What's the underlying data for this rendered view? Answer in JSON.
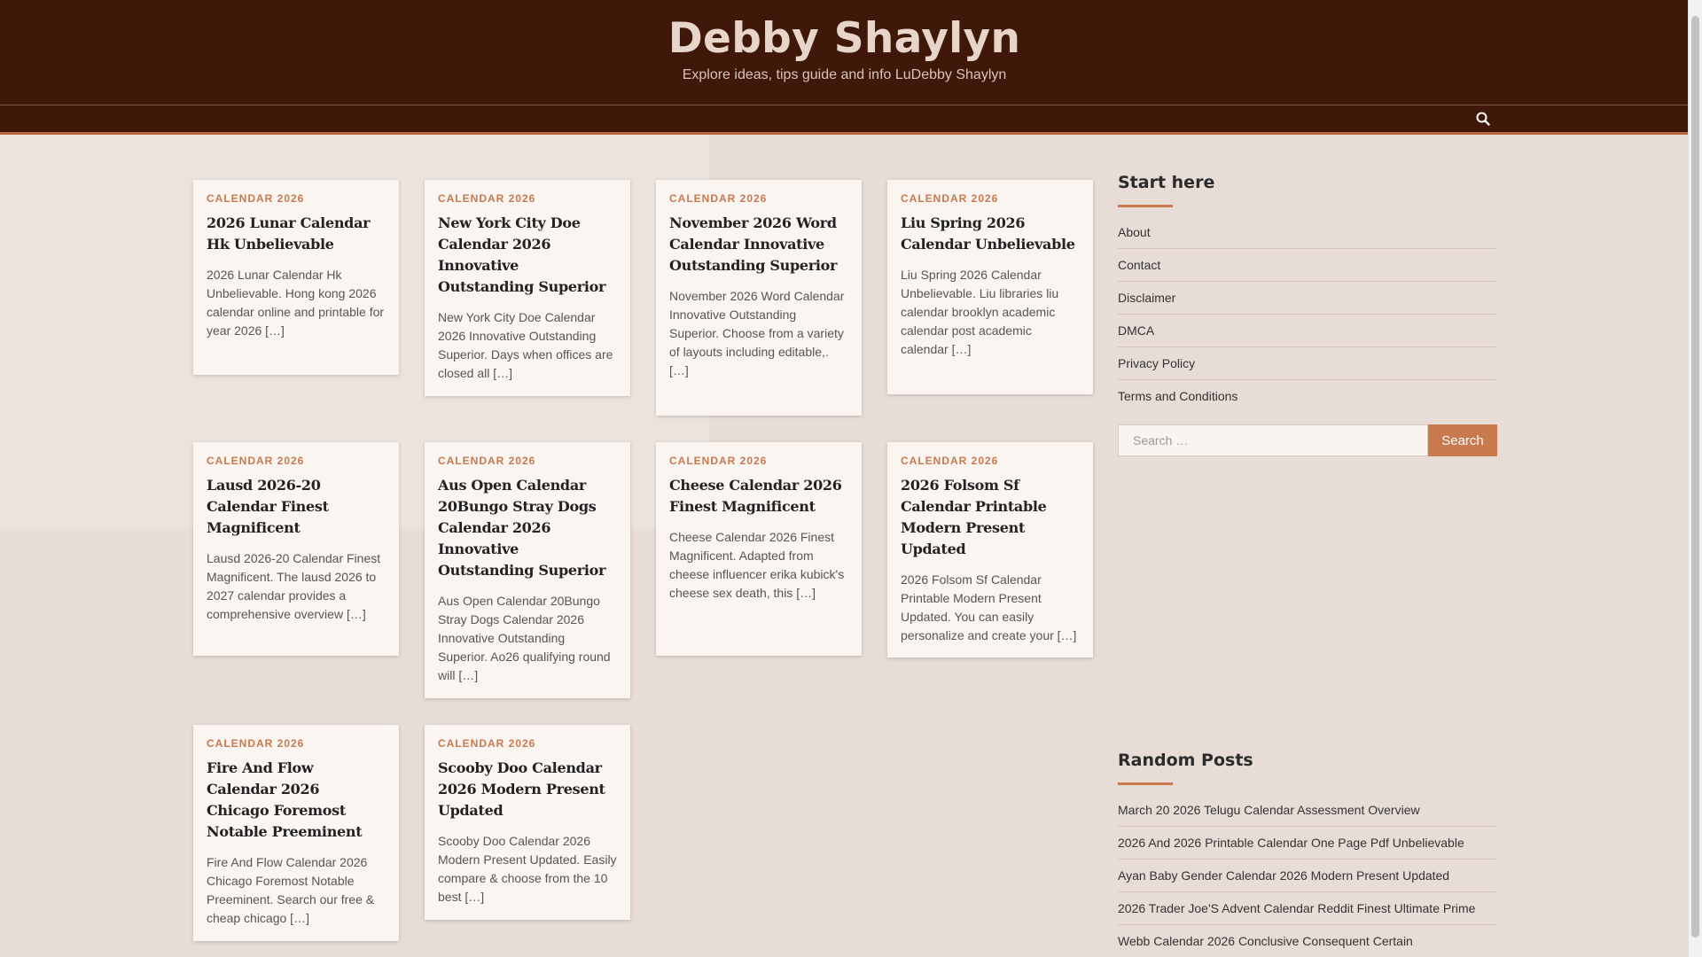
{
  "site": {
    "title": "Debby Shaylyn",
    "description": "Explore ideas, tips guide and info LuDebby Shaylyn"
  },
  "nav": {
    "search_icon": "search-icon"
  },
  "posts": [
    {
      "category": "CALENDAR 2026",
      "title": "2026 Lunar Calendar Hk Unbelievable",
      "excerpt": "2026 Lunar Calendar Hk Unbelievable. Hong kong 2026 calendar online and printable for year 2026 […]"
    },
    {
      "category": "CALENDAR 2026",
      "title": "New York City Doe Calendar 2026 Innovative Outstanding Superior",
      "excerpt": "New York City Doe Calendar 2026 Innovative Outstanding Superior. Days when offices are closed all […]"
    },
    {
      "category": "CALENDAR 2026",
      "title": "November 2026 Word Calendar Innovative Outstanding Superior",
      "excerpt": "November 2026 Word Calendar Innovative Outstanding Superior. Choose from a variety of layouts including editable,. […]"
    },
    {
      "category": "CALENDAR 2026",
      "title": "Liu Spring 2026 Calendar Unbelievable",
      "excerpt": "Liu Spring 2026 Calendar Unbelievable. Liu libraries liu calendar brooklyn academic calendar post academic calendar […]"
    },
    {
      "category": "CALENDAR 2026",
      "title": "Lausd 2026-20 Calendar Finest Magnificent",
      "excerpt": "Lausd 2026-20 Calendar Finest Magnificent. The lausd 2026 to 2027 calendar provides a comprehensive overview […]"
    },
    {
      "category": "CALENDAR 2026",
      "title": "Aus Open Calendar 20Bungo Stray Dogs Calendar 2026 Innovative Outstanding Superior",
      "excerpt": "Aus Open Calendar 20Bungo Stray Dogs Calendar 2026 Innovative Outstanding Superior. Ao26 qualifying round will […]"
    },
    {
      "category": "CALENDAR 2026",
      "title": "Cheese Calendar 2026 Finest Magnificent",
      "excerpt": "Cheese Calendar 2026 Finest Magnificent. Adapted from cheese influencer erika kubick's cheese sex death, this […]"
    },
    {
      "category": "CALENDAR 2026",
      "title": "2026 Folsom Sf Calendar Printable Modern Present Updated",
      "excerpt": "2026 Folsom Sf Calendar Printable Modern Present Updated. You can easily personalize and create your […]"
    },
    {
      "category": "CALENDAR 2026",
      "title": "Fire And Flow Calendar 2026 Chicago Foremost Notable Preeminent",
      "excerpt": "Fire And Flow Calendar 2026 Chicago Foremost Notable Preeminent. Search our free & cheap chicago […]"
    },
    {
      "category": "CALENDAR 2026",
      "title": "Scooby Doo Calendar 2026 Modern Present Updated",
      "excerpt": "Scooby Doo Calendar 2026 Modern Present Updated. Easily compare & choose from the 10 best […]"
    }
  ],
  "sidebar": {
    "start_title": "Start here",
    "links": [
      "About",
      "Contact",
      "Disclaimer",
      "DMCA",
      "Privacy Policy",
      "Terms and Conditions"
    ],
    "search": {
      "placeholder": "Search …",
      "button": "Search"
    },
    "random_title": "Random Posts",
    "random_posts": [
      "March 20 2026 Telugu Calendar Assessment Overview",
      "2026 And 2026 Printable Calendar One Page Pdf Unbelievable",
      "Ayan Baby Gender Calendar 2026 Modern Present Updated",
      "2026 Trader Joe'S Advent Calendar Reddit Finest Ultimate Prime",
      "Webb Calendar 2026 Conclusive Consequent Certain"
    ]
  },
  "colors": {
    "header_bg": "#3f1809",
    "accent": "#c8794d",
    "page_bg": "#e7dcd6"
  }
}
